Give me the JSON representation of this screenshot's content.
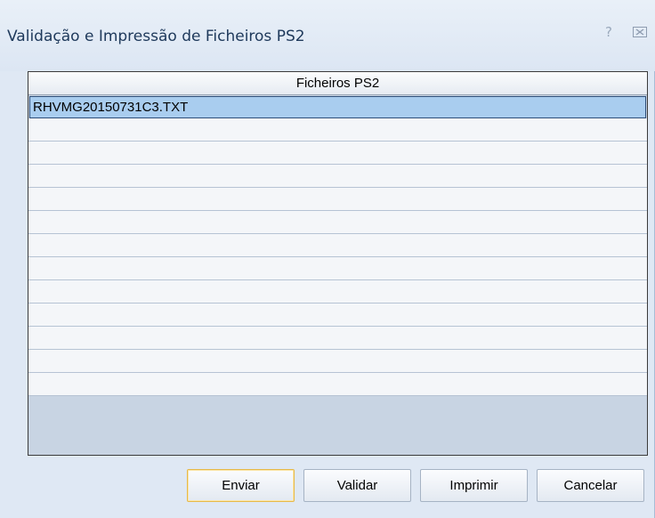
{
  "window": {
    "title": "Validação e Impressão de Ficheiros PS2",
    "help_glyph": "?"
  },
  "grid": {
    "column_header": "Ficheiros PS2",
    "rows": [
      "RHVMG20150731C3.TXT",
      "",
      "",
      "",
      "",
      "",
      "",
      "",
      "",
      "",
      "",
      "",
      ""
    ],
    "selected_row": 0
  },
  "buttons": {
    "send": "Enviar",
    "validate": "Validar",
    "print": "Imprimir",
    "cancel": "Cancelar"
  },
  "colors": {
    "title_text": "#1e395b",
    "selection": "#a9cdef",
    "default_button_border": "#e6b94a"
  }
}
